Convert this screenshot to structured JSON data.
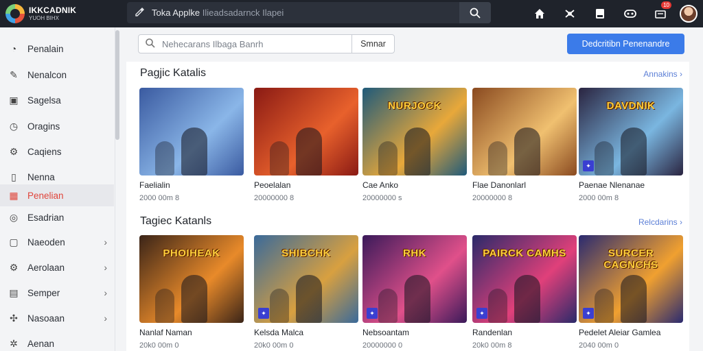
{
  "app": {
    "logo_title": "IKKCADNIK",
    "logo_subtitle": "YUOH BIHX"
  },
  "topbar": {
    "search_query": "Toka Applke",
    "search_rest": "Ilieadsadarnck Ilapei",
    "notification_badge": "10"
  },
  "sidebar": {
    "items": [
      {
        "label": "Penalain",
        "icon": "dashboard-icon",
        "active": false,
        "chevron": false
      },
      {
        "label": "Nenalcon",
        "icon": "pencil-icon",
        "active": false,
        "chevron": false
      },
      {
        "label": "Sagelsa",
        "icon": "calendar-icon",
        "active": false,
        "chevron": false
      },
      {
        "label": "Oragins",
        "icon": "clock-icon",
        "active": false,
        "chevron": false
      },
      {
        "label": "Caqiens",
        "icon": "settings-icon",
        "active": false,
        "chevron": false
      },
      {
        "label": "Nenna",
        "icon": "bookmark-icon",
        "active": false,
        "chevron": false
      },
      {
        "label": "Penelian",
        "icon": "grid-icon",
        "active": true,
        "chevron": false
      },
      {
        "label": "Esadrian",
        "icon": "compass-icon",
        "active": false,
        "chevron": false
      },
      {
        "label": "Naeoden",
        "icon": "box-icon",
        "active": false,
        "chevron": true
      },
      {
        "label": "Aerolaan",
        "icon": "gear-icon",
        "active": false,
        "chevron": true
      },
      {
        "label": "Semper",
        "icon": "list-icon",
        "active": false,
        "chevron": true
      },
      {
        "label": "Nasoaan",
        "icon": "puzzle-icon",
        "active": false,
        "chevron": true
      },
      {
        "label": "Aenan",
        "icon": "cog-icon",
        "active": false,
        "chevron": false
      }
    ]
  },
  "filter": {
    "search_placeholder": "Nehecarans Ilbaga Banrh",
    "search_button": "Smnar",
    "primary_button": "Dedcritibn Penenandre"
  },
  "sections": [
    {
      "title": "Pagjic Katalis",
      "link": "Annakins ›",
      "cards": [
        {
          "title": "Faelialin",
          "meta": "2000 00m 8",
          "colors": [
            "#3a5aa0",
            "#8ab6e8"
          ],
          "banner": ""
        },
        {
          "title": "Peoelalan",
          "meta": "20000000 8",
          "colors": [
            "#8a1a14",
            "#e8612c"
          ],
          "banner": ""
        },
        {
          "title": "Cae Anko",
          "meta": "20000000 s",
          "colors": [
            "#1f5a7a",
            "#e8a83a"
          ],
          "banner": "NURJOCK"
        },
        {
          "title": "Flae Danonlarl",
          "meta": "20000000 8",
          "colors": [
            "#8a4a20",
            "#f0c070"
          ],
          "banner": ""
        },
        {
          "title": "Paenae Nlenanae",
          "meta": "2000 00m 8",
          "colors": [
            "#2a2440",
            "#7ab6e0"
          ],
          "banner": "DAVDNIK"
        }
      ]
    },
    {
      "title": "Tagiec Katanls",
      "link": "Relcdarins ›",
      "cards": [
        {
          "title": "Nanlaf Naman",
          "meta": "20k0 00m 0",
          "colors": [
            "#3a2418",
            "#e88a2a"
          ],
          "banner": "PHOIHEAK"
        },
        {
          "title": "Kelsda Malca",
          "meta": "20k0 00m 0",
          "colors": [
            "#3a6a9a",
            "#d8a040"
          ],
          "banner": "SHIBCHK"
        },
        {
          "title": "Nebsoantam",
          "meta": "20000000 0",
          "colors": [
            "#3a1a5a",
            "#e0508a"
          ],
          "banner": "RHK"
        },
        {
          "title": "Randenlan",
          "meta": "20k0 00m 8",
          "colors": [
            "#2a2a6a",
            "#e0407a"
          ],
          "banner": "PAIRCK CAMHS"
        },
        {
          "title": "Pedelet Aleiar Gamlea",
          "meta": "2040 00m 0",
          "colors": [
            "#2a2a70",
            "#f0a030"
          ],
          "banner": "SURCER CAGNCHS"
        }
      ]
    }
  ]
}
